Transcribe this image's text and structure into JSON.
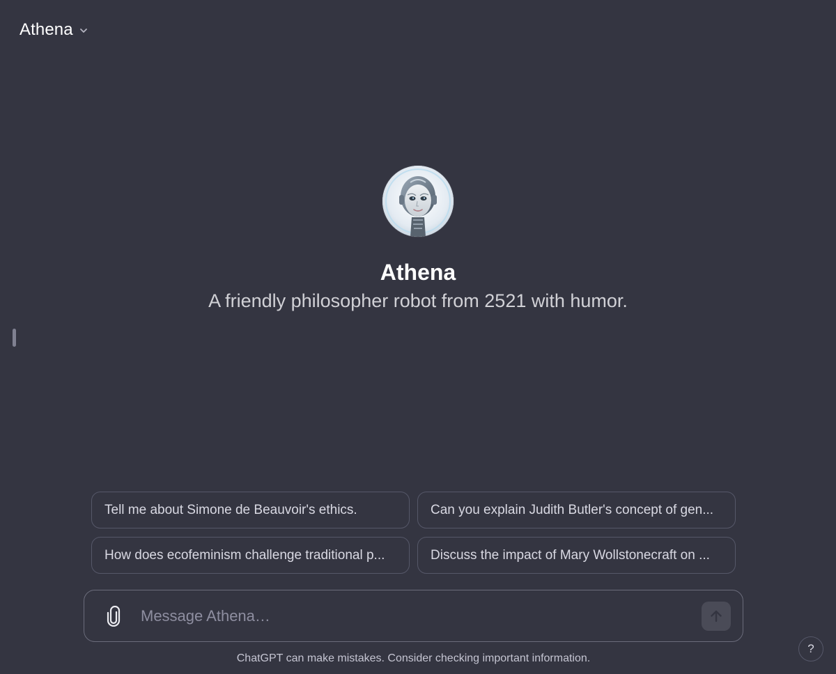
{
  "header": {
    "title": "Athena",
    "chevron_icon": "chevron-down-icon"
  },
  "gpt": {
    "name": "Athena",
    "description": "A friendly philosopher robot from 2521 with humor."
  },
  "starters": [
    {
      "label": "Tell me about Simone de Beauvoir's ethics."
    },
    {
      "label": "Can you explain Judith Butler's concept of gen..."
    },
    {
      "label": "How does ecofeminism challenge traditional p..."
    },
    {
      "label": "Discuss the impact of Mary Wollstonecraft on ..."
    }
  ],
  "composer": {
    "placeholder": "Message Athena…",
    "attach_icon": "paperclip-icon",
    "send_icon": "arrow-up-icon"
  },
  "footer": {
    "disclaimer": "ChatGPT can make mistakes. Consider checking important information.",
    "help_label": "?"
  },
  "colors": {
    "background": "#343541",
    "border": "#565869",
    "text": "#ececf1",
    "muted": "#8e8ea0"
  }
}
